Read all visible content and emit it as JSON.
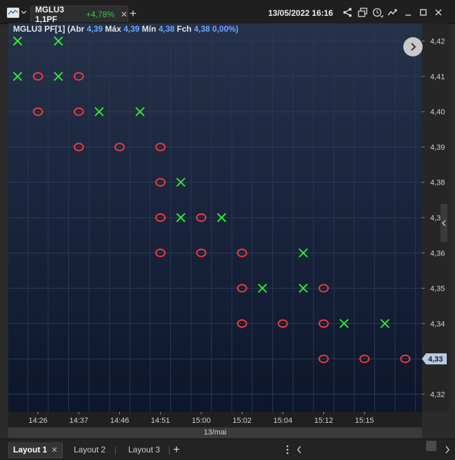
{
  "toolbar": {
    "tab_symbol": "MGLU3 1,1PF",
    "tab_change": "+4,78%",
    "close_glyph": "✕",
    "add_glyph": "+",
    "datetime": "13/05/2022 16:16"
  },
  "legend": {
    "label": "MGLU3 PF[1]",
    "open_label": "(Abr",
    "open": "4,39",
    "high_label": "Máx",
    "high": "4,39",
    "low_label": "Mín",
    "low": "4,38",
    "close_label": "Fch",
    "close": "4,38",
    "pct": "0,00%)"
  },
  "date_label": "13/mai",
  "layouts": [
    {
      "label": "Layout 1"
    },
    {
      "label": "Layout 2"
    },
    {
      "label": "Layout 3"
    }
  ],
  "colors": {
    "x_color": "#2ee82e",
    "o_color": "#ff3b3b",
    "last_price_bg": "#b9cbe3"
  },
  "chart_data": {
    "type": "scatter",
    "subtype": "point-and-figure",
    "title": "",
    "xlabel": "",
    "ylabel": "",
    "ylim": [
      4.315,
      4.425
    ],
    "yticks": [
      "4,42",
      "4,41",
      "4,40",
      "4,39",
      "4,38",
      "4,37",
      "4,36",
      "4,35",
      "4,34",
      "4,33",
      "4,32"
    ],
    "ytick_values": [
      4.42,
      4.41,
      4.4,
      4.39,
      4.38,
      4.37,
      4.36,
      4.35,
      4.34,
      4.33,
      4.32
    ],
    "xticks": [
      "14:26",
      "14:37",
      "14:46",
      "14:51",
      "15:00",
      "15:02",
      "15:04",
      "15:12",
      "15:15"
    ],
    "xtick_columns": [
      1,
      3,
      5,
      7,
      9,
      11,
      13,
      15,
      17
    ],
    "last_price": "4,33",
    "last_price_value": 4.33,
    "columns": [
      {
        "col": 0,
        "mark": "X",
        "prices": [
          4.41,
          4.42
        ]
      },
      {
        "col": 1,
        "mark": "O",
        "prices": [
          4.41,
          4.4
        ]
      },
      {
        "col": 2,
        "mark": "X",
        "prices": [
          4.41,
          4.42
        ]
      },
      {
        "col": 3,
        "mark": "O",
        "prices": [
          4.41,
          4.4,
          4.39
        ]
      },
      {
        "col": 4,
        "mark": "X",
        "prices": [
          4.4
        ]
      },
      {
        "col": 5,
        "mark": "O",
        "prices": [
          4.39
        ]
      },
      {
        "col": 6,
        "mark": "X",
        "prices": [
          4.4
        ]
      },
      {
        "col": 7,
        "mark": "O",
        "prices": [
          4.39,
          4.38,
          4.37,
          4.36
        ]
      },
      {
        "col": 8,
        "mark": "X",
        "prices": [
          4.37,
          4.38
        ]
      },
      {
        "col": 9,
        "mark": "O",
        "prices": [
          4.37,
          4.36
        ]
      },
      {
        "col": 10,
        "mark": "X",
        "prices": [
          4.37
        ]
      },
      {
        "col": 11,
        "mark": "O",
        "prices": [
          4.36,
          4.35,
          4.34
        ]
      },
      {
        "col": 12,
        "mark": "X",
        "prices": [
          4.35
        ]
      },
      {
        "col": 13,
        "mark": "O",
        "prices": [
          4.34
        ]
      },
      {
        "col": 14,
        "mark": "X",
        "prices": [
          4.35,
          4.36
        ]
      },
      {
        "col": 15,
        "mark": "O",
        "prices": [
          4.35,
          4.34,
          4.33
        ]
      },
      {
        "col": 16,
        "mark": "X",
        "prices": [
          4.34
        ]
      },
      {
        "col": 17,
        "mark": "O",
        "prices": [
          4.33
        ]
      },
      {
        "col": 18,
        "mark": "X",
        "prices": [
          4.34
        ]
      },
      {
        "col": 19,
        "mark": "O",
        "prices": [
          4.33
        ]
      }
    ]
  }
}
